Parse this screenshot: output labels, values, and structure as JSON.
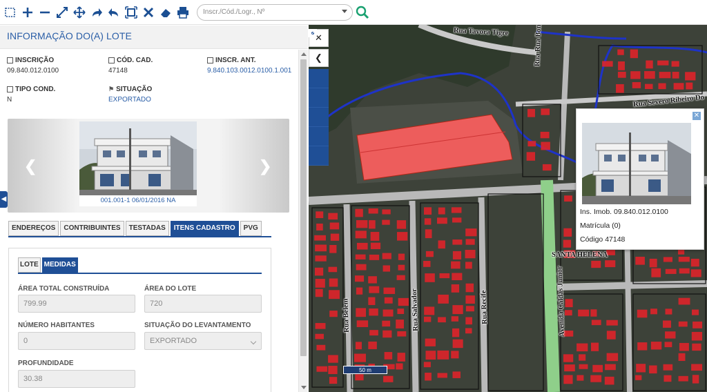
{
  "toolbar": {
    "icons": [
      "select-box-icon",
      "zoom-in-icon",
      "zoom-out-icon",
      "full-extent-icon",
      "pan-icon",
      "forward-icon",
      "back-icon",
      "zoom-box-icon",
      "clear-icon",
      "eraser-icon",
      "print-icon"
    ],
    "search_placeholder": "Inscr./Cód./Logr., Nº"
  },
  "panel": {
    "title": "INFORMAÇÃO DO(A) LOTE",
    "fields": {
      "inscricao_label": "INSCRIÇÃO",
      "inscricao_value": "09.840.012.0100",
      "cod_cad_label": "CÓD. CAD.",
      "cod_cad_value": "47148",
      "inscr_ant_label": "INSCR. ANT.",
      "inscr_ant_value": "9.840.103.0012.0100.1.001",
      "tipo_cond_label": "TIPO COND.",
      "tipo_cond_value": "N",
      "situacao_label": "SITUAÇÃO",
      "situacao_value": "EXPORTADO"
    },
    "photo_caption": "001.001-1 06/01/2016 NA",
    "tabs": [
      "ENDEREÇOS",
      "CONTRIBUINTES",
      "TESTADAS",
      "ITENS CADASTRO",
      "PVG"
    ],
    "active_tab": "ITENS CADASTRO",
    "subtabs": [
      "LOTE",
      "MEDIDAS"
    ],
    "active_subtab": "MEDIDAS",
    "form": {
      "area_total_label": "ÁREA TOTAL CONSTRUÍDA",
      "area_total_value": "799.99",
      "area_lote_label": "ÁREA DO LOTE",
      "area_lote_value": "720",
      "num_hab_label": "NÚMERO HABITANTES",
      "num_hab_value": "0",
      "sit_lev_label": "SITUAÇÃO DO LEVANTAMENTO",
      "sit_lev_value": "EXPORTADO",
      "profundidade_label": "PROFUNDIDADE",
      "profundidade_value": "30.38"
    }
  },
  "map": {
    "streets": {
      "tavora": "Rua Tavora Tigre",
      "bom_jesus": "Rua Rua Bom Jesus",
      "severo": "Rua Severo Ribeiro Do",
      "santa_helena": "SANTA HELENA",
      "caldas": "Avenida Caldas Junior",
      "belem": "Rua Belem",
      "salvador": "Rua Salvador",
      "recife": "Rua Recife"
    },
    "popup": {
      "ins_imob": "Ins. Imob. 09.840.012.0100",
      "matricula": "Matrícula (0)",
      "codigo": "Código 47148"
    },
    "scale_label": "50 m"
  }
}
